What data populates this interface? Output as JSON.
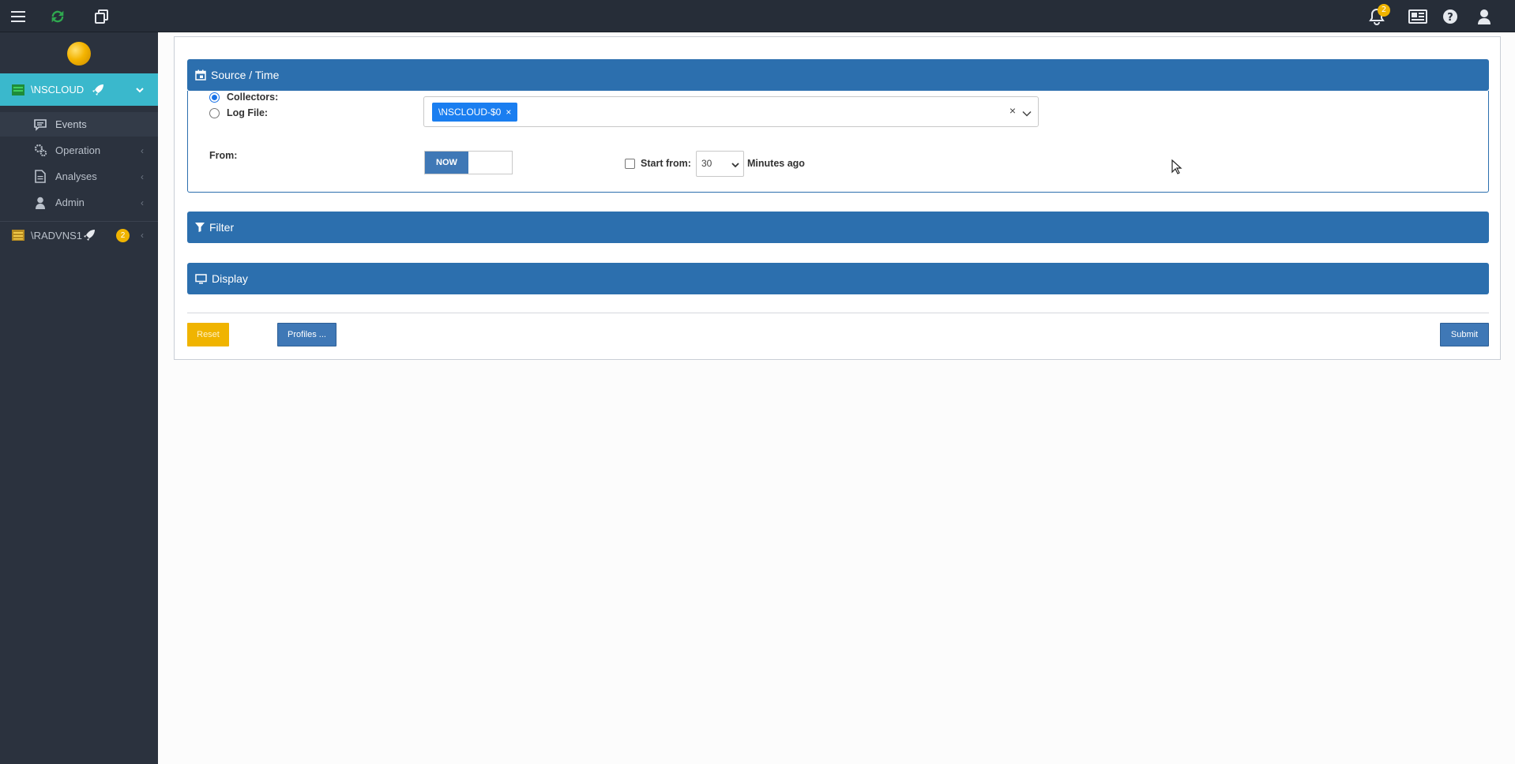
{
  "topbar": {
    "icons": [
      "menu-icon",
      "refresh-icon",
      "copy-icon",
      "bell-icon",
      "news-icon",
      "help-icon",
      "user-icon"
    ],
    "bell_badge": "2",
    "refresh_color": "#2fa84f"
  },
  "sidebar": {
    "node_active": {
      "label": "\\NSCLOUD",
      "color": "#3ab8cc"
    },
    "items": [
      {
        "label": "Events",
        "icon": "comment-icon"
      },
      {
        "label": "Operation",
        "icon": "gears-icon"
      },
      {
        "label": "Analyses",
        "icon": "document-icon"
      },
      {
        "label": "Admin",
        "icon": "person-icon"
      }
    ],
    "node2": {
      "label": "\\RADVNS1",
      "badge": "2"
    }
  },
  "main": {
    "source_panel": {
      "title": "Source / Time",
      "collectors_label": "Collectors:",
      "logfile_label": "Log File:",
      "selected_source": "\\NSCLOUD-$0",
      "from_label": "From:",
      "toggle_now": "NOW",
      "start_from_label": "Start from:",
      "minutes_value": "30",
      "minutes_suffix": "Minutes ago"
    },
    "filter_panel": {
      "title": "Filter"
    },
    "display_panel": {
      "title": "Display"
    },
    "buttons": {
      "reset": "Reset",
      "profiles": "Profiles ...",
      "submit": "Submit"
    },
    "colors": {
      "panel_header": "#2c6fae",
      "button_primary": "#3f78b6",
      "button_warning": "#f0b400"
    }
  }
}
